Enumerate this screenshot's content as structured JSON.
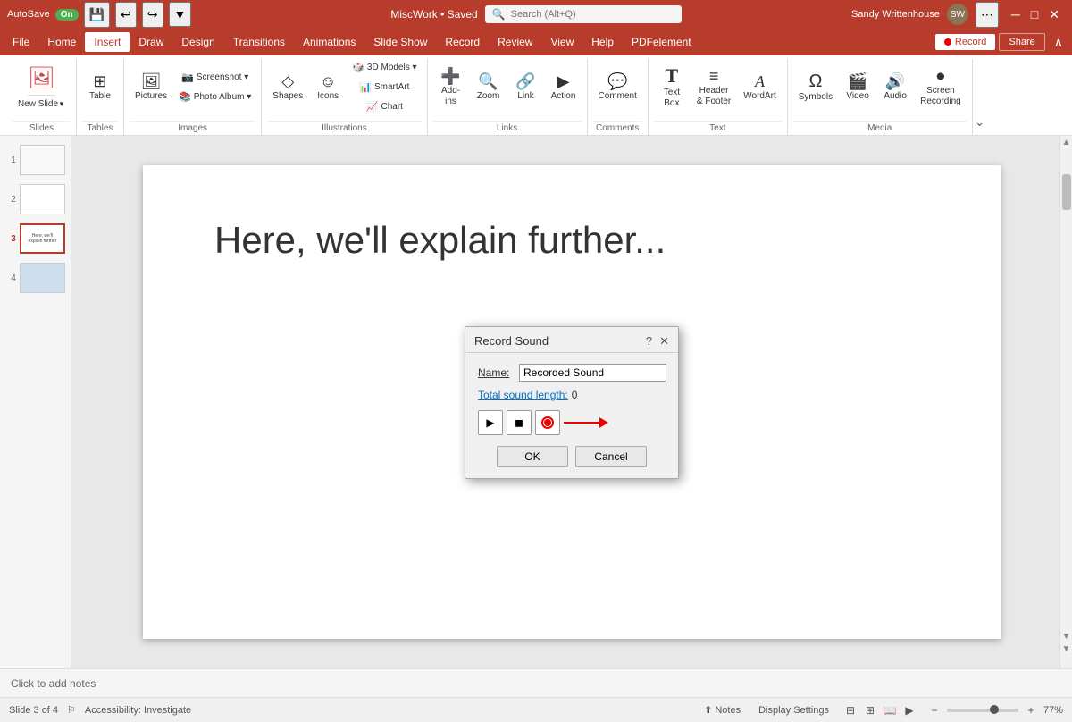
{
  "titleBar": {
    "autosave": "AutoSave",
    "autosaveState": "On",
    "appName": "MiscWork • Saved",
    "searchPlaceholder": "Search (Alt+Q)",
    "userName": "Sandy Writtenhouse",
    "undoIcon": "↩",
    "redoIcon": "↪",
    "customizeIcon": "▼",
    "minimizeIcon": "─",
    "maximizeIcon": "□",
    "closeIcon": "✕"
  },
  "menuBar": {
    "items": [
      "File",
      "Home",
      "Insert",
      "Draw",
      "Design",
      "Transitions",
      "Animations",
      "Slide Show",
      "Record",
      "Review",
      "View",
      "Help",
      "PDFelement"
    ],
    "activeItem": "Insert",
    "recordBtn": "Record",
    "shareBtn": "Share"
  },
  "ribbon": {
    "groups": [
      {
        "name": "Slides",
        "items": [
          {
            "label": "New\nSlide",
            "icon": "🖼"
          }
        ]
      },
      {
        "name": "Tables",
        "items": [
          {
            "label": "Table",
            "icon": "⊞"
          }
        ]
      },
      {
        "name": "Images",
        "items": [
          {
            "label": "Pictures",
            "icon": "🖼"
          },
          {
            "label": "Screenshot",
            "icon": "📷"
          },
          {
            "label": "Photo Album",
            "icon": "📚"
          }
        ]
      },
      {
        "name": "Illustrations",
        "items": [
          {
            "label": "Shapes",
            "icon": "◇"
          },
          {
            "label": "Icons",
            "icon": "☺"
          },
          {
            "label": "3D Models",
            "icon": "🎲"
          },
          {
            "label": "SmartArt",
            "icon": "📊"
          },
          {
            "label": "Chart",
            "icon": "📈"
          }
        ]
      },
      {
        "name": "Links",
        "items": [
          {
            "label": "Add-ins",
            "icon": "➕"
          },
          {
            "label": "Zoom",
            "icon": "🔍"
          },
          {
            "label": "Link",
            "icon": "🔗"
          },
          {
            "label": "Action",
            "icon": "▶"
          }
        ]
      },
      {
        "name": "Comments",
        "items": [
          {
            "label": "Comment",
            "icon": "💬"
          }
        ]
      },
      {
        "name": "Text",
        "items": [
          {
            "label": "Text\nBox",
            "icon": "T"
          },
          {
            "label": "Header\n& Footer",
            "icon": "≡"
          },
          {
            "label": "WordArt",
            "icon": "A"
          }
        ]
      },
      {
        "name": "Media",
        "items": [
          {
            "label": "Symbols",
            "icon": "Ω"
          },
          {
            "label": "Video",
            "icon": "🎬"
          },
          {
            "label": "Audio",
            "icon": "🔊"
          },
          {
            "label": "Screen\nRecording",
            "icon": "⏺"
          }
        ]
      }
    ]
  },
  "slides": [
    {
      "num": 1,
      "content": ""
    },
    {
      "num": 2,
      "content": ""
    },
    {
      "num": 3,
      "content": "",
      "active": true
    },
    {
      "num": 4,
      "content": ""
    }
  ],
  "slideContent": {
    "text": "Here, we'll explain further..."
  },
  "dialog": {
    "title": "Record Sound",
    "nameLabel": "Name:",
    "nameValue": "Recorded Sound",
    "soundLengthLabel": "Total sound length:",
    "soundLengthValue": "0",
    "playIcon": "▶",
    "stopIcon": "◼",
    "okLabel": "OK",
    "cancelLabel": "Cancel"
  },
  "statusBar": {
    "slideInfo": "Slide 3 of 4",
    "accessibility": "Accessibility: Investigate",
    "notesLabel": "Notes",
    "displaySettings": "Display Settings",
    "zoomLevel": "77%"
  },
  "notesBar": {
    "placeholder": "Click to add notes"
  }
}
